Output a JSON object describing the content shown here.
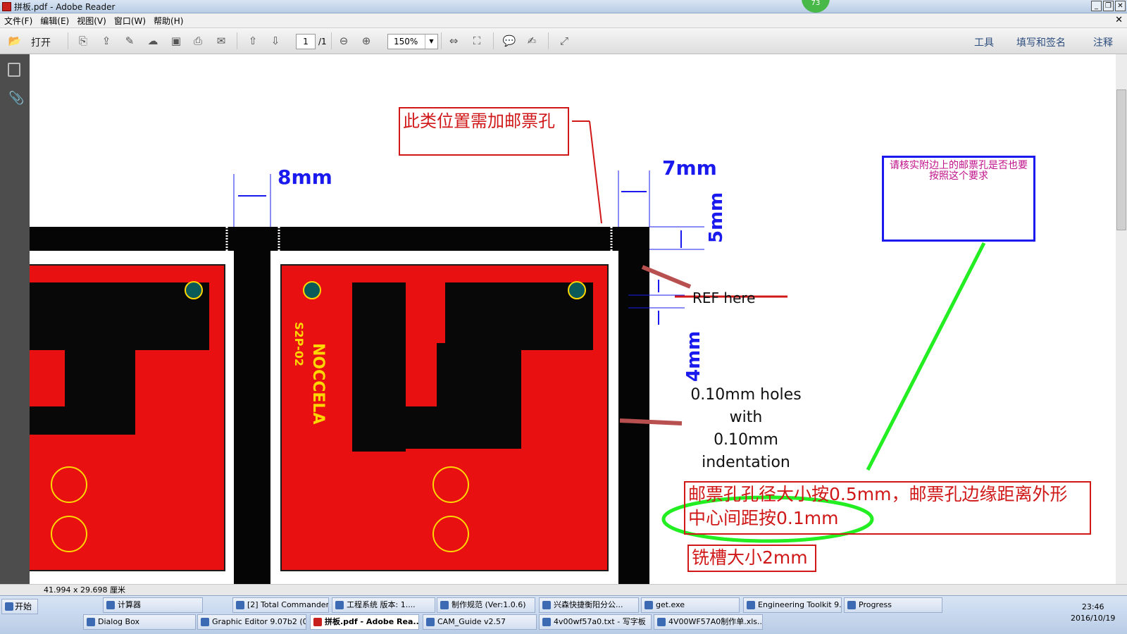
{
  "window": {
    "title": "拼板.pdf - Adobe Reader",
    "badge": "73"
  },
  "menu": {
    "items": [
      "文件(F)",
      "编辑(E)",
      "视图(V)",
      "窗口(W)",
      "帮助(H)"
    ]
  },
  "toolbar": {
    "open_label": "打开",
    "page_current": "1",
    "page_total": "/1",
    "zoom": "150%",
    "tools": "工具",
    "fill_sign": "填写和签名",
    "comment": "注释"
  },
  "status": {
    "page_size": "41.994 x 29.698 厘米"
  },
  "annotations": {
    "callout_stamp": "此类位置需加邮票孔",
    "dim_8mm": "8mm",
    "dim_7mm": "7mm",
    "dim_5mm": "5mm",
    "dim_4mm": "4mm",
    "blue_note": "请核实附边上的邮票孔是否也要按照这个要求",
    "ref_here": "REF here",
    "holes_note_1": "0.10mm holes",
    "holes_note_2": "with",
    "holes_note_3": "0.10mm",
    "holes_note_4": "indentation",
    "spec_line1": "邮票孔孔径大小按0.5mm，邮票孔边缘距离外形",
    "spec_line2": "中心间距按0.1mm",
    "slot_note": "铣槽大小2mm"
  },
  "pcb": {
    "brand": "NOCCELA",
    "model": "S2P-02"
  },
  "taskbar": {
    "start": "开始",
    "row1": [
      "计算器",
      "[2] Total Commander...",
      "工程系统  版本: 1....",
      "制作规范 (Ver:1.0.6)",
      "兴森快捷衡阳分公...",
      "get.exe",
      "Engineering Toolkit 9....",
      "Progress"
    ],
    "row2": [
      "Dialog Box",
      "Graphic Editor 9.07b2 (0...",
      "拼板.pdf - Adobe Rea...",
      "CAM_Guide v2.57",
      "4v00wf57a0.txt - 写字板",
      "4V00WF57A0制作单.xls..."
    ],
    "time": "23:46",
    "date": "2016/10/19"
  }
}
